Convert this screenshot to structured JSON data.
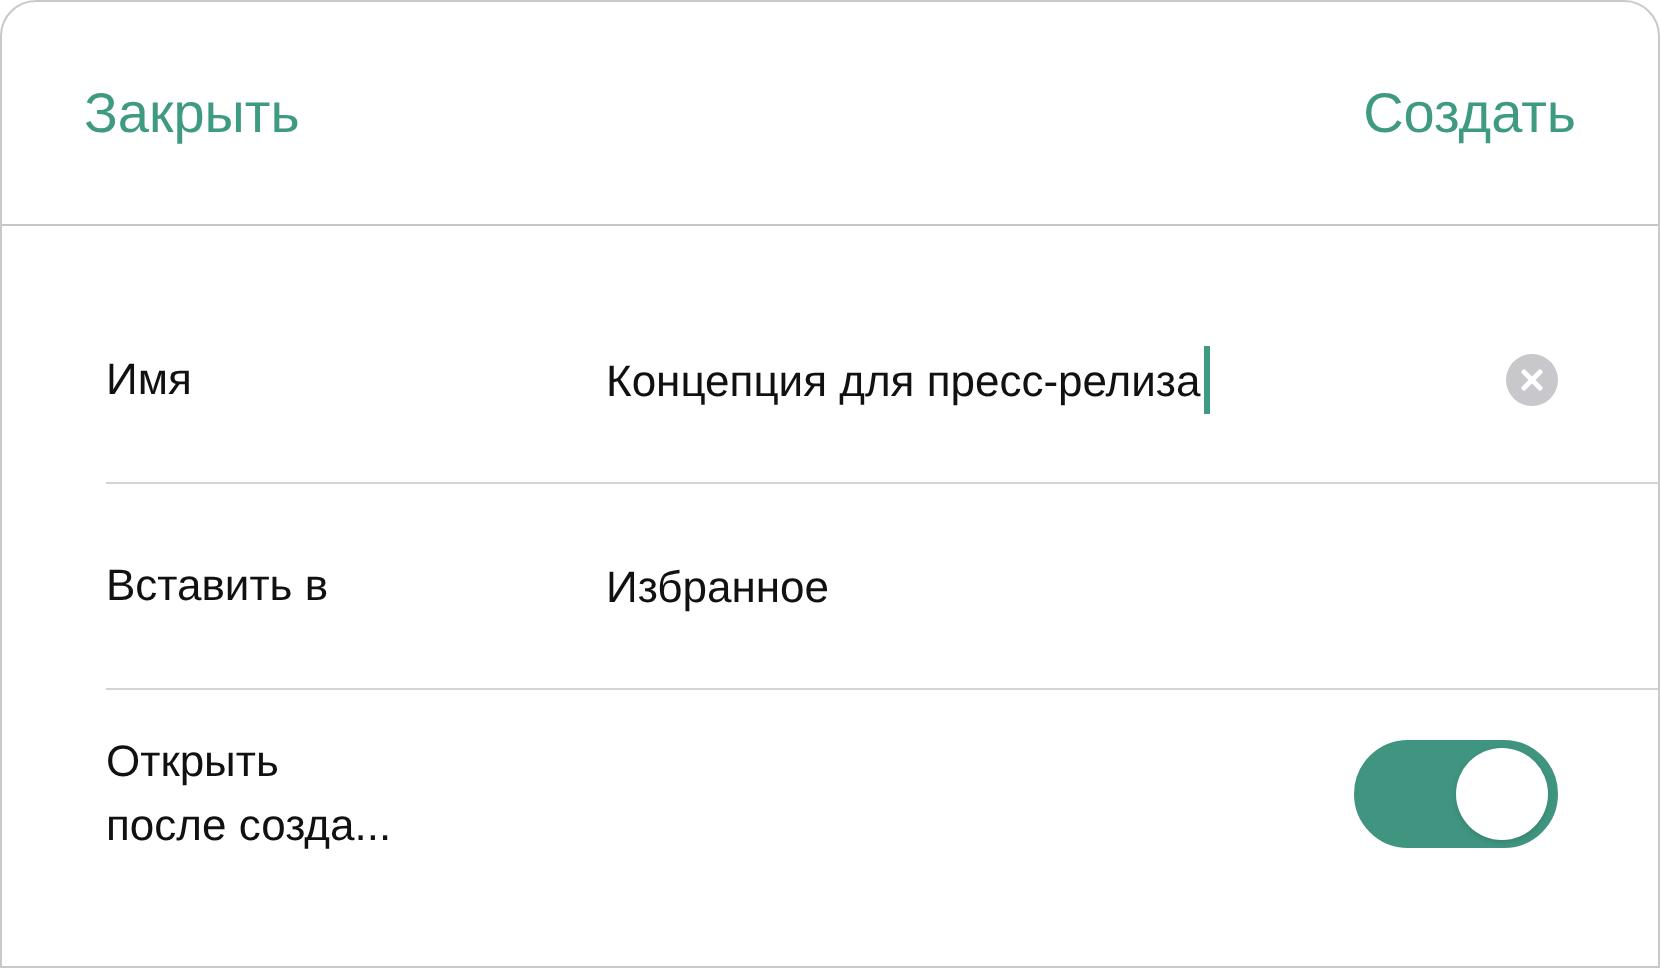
{
  "header": {
    "close_button": "Закрыть",
    "create_button": "Создать"
  },
  "fields": [
    {
      "kind": "text",
      "label": "Имя",
      "value": "Концепция для пресс-релиза",
      "focused": true
    },
    {
      "kind": "value",
      "label": "Вставить в",
      "value": "Избранное"
    },
    {
      "kind": "toggle",
      "label": "Открыть\nпосле созда...",
      "on": true
    }
  ]
}
